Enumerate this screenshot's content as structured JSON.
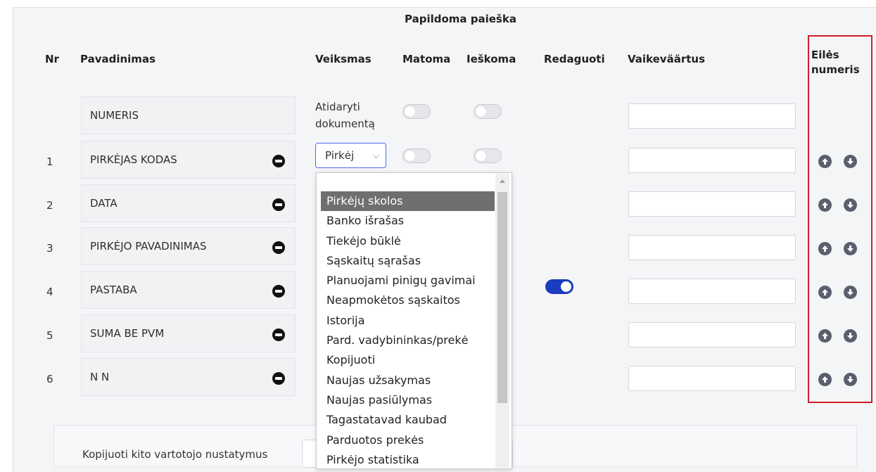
{
  "section_title": "Papildoma paieška",
  "headers": {
    "nr": "Nr",
    "name": "Pavadinimas",
    "action": "Veiksmas",
    "visible": "Matoma",
    "searchable": "Ieškoma",
    "edit": "Redaguoti",
    "default_value": "Vaikeväärtus",
    "order_line1": "Eilės",
    "order_line2": "numeris"
  },
  "first_row": {
    "name": "NUMERIS",
    "action_line1": "Atidaryti",
    "action_line2": "dokumentą",
    "visible": false,
    "searchable": false
  },
  "rows": [
    {
      "nr": "1",
      "name": "PIRKĖJAS KODAS",
      "visible": false,
      "searchable": false
    },
    {
      "nr": "2",
      "name": "DATA"
    },
    {
      "nr": "3",
      "name": "PIRKĖJO PAVADINIMAS"
    },
    {
      "nr": "4",
      "name": "PASTABA",
      "edit": true
    },
    {
      "nr": "5",
      "name": "SUMA BE PVM"
    },
    {
      "nr": "6",
      "name": "N N"
    }
  ],
  "action_select": {
    "value": "Pirkėj",
    "options": [
      "Pirkėjų skolos",
      "Banko išrašas",
      "Tiekėjo būklė",
      "Sąskaitų sąrašas",
      "Planuojami pinigų gavimai",
      "Neapmokėtos sąskaitos",
      "Istorija",
      "Pard. vadybininkas/prekė",
      "Kopijuoti",
      "Naujas užsakymas",
      "Naujas pasiūlymas",
      "Tagastatavad kaubad",
      "Parduotos prekės",
      "Pirkėjo statistika"
    ],
    "selected_index": 0
  },
  "copy_settings_label": "Kopijuoti kito vartotojo nustatymus",
  "colors": {
    "toggle_on": "#1c3cbf",
    "highlight_frame": "#d0202a",
    "selected_option": "#6f6f6f"
  }
}
